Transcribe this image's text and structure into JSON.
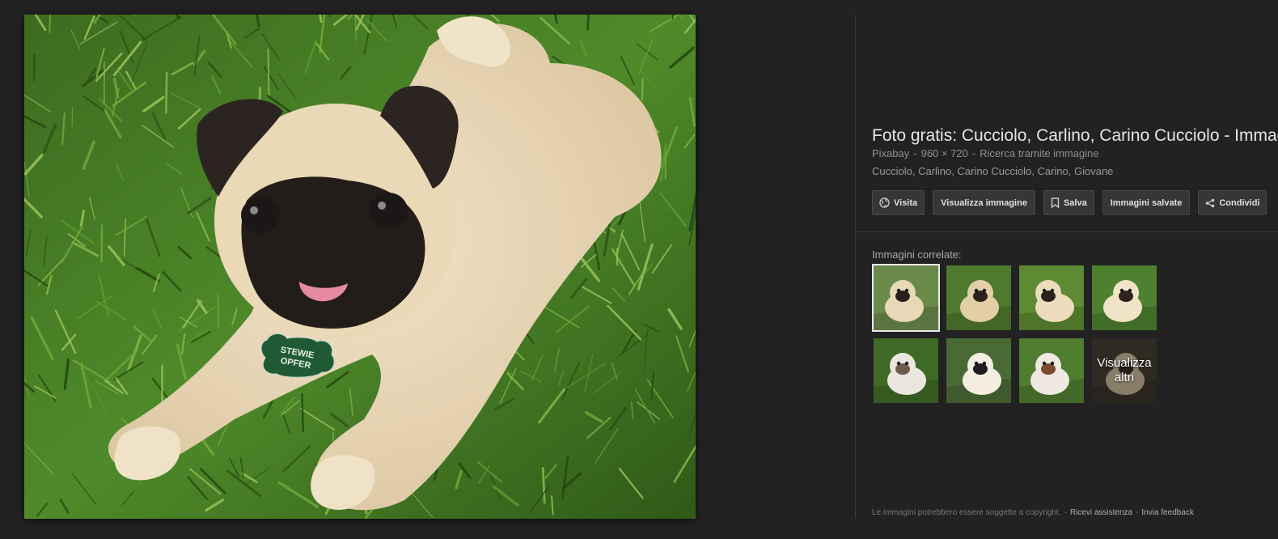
{
  "preview": {
    "tag_text_line1": "STEWIE",
    "tag_text_line2": "OPFER"
  },
  "info": {
    "title": "Foto gratis: Cucciolo, Carlino, Carino Cucciolo - Immagine gratis su Pixabay",
    "source": "Pixabay",
    "dimensions": "960 × 720",
    "search_by_image": "Ricerca tramite immagine",
    "tags": "Cucciolo, Carlino, Carino Cucciolo, Carino, Giovane"
  },
  "buttons": {
    "visit": {
      "label": "Visita",
      "icon": "globe-icon"
    },
    "view_image": {
      "label": "Visualizza immagine"
    },
    "save": {
      "label": "Salva",
      "icon": "bookmark-icon"
    },
    "saved_images": {
      "label": "Immagini salvate"
    },
    "share": {
      "label": "Condividi",
      "icon": "share-icon"
    }
  },
  "related": {
    "label": "Immagini correlate:",
    "view_more_label": "Visualizza altri",
    "thumbnails": [
      {
        "desc": "pug lying on grass",
        "bg": "#6a8a4a",
        "dog": "#e7d8b8",
        "face": "#2a211c",
        "selected": true
      },
      {
        "desc": "pug puppy on grass",
        "bg": "#4f7a2e",
        "dog": "#e2cfa8",
        "face": "#2b221c",
        "selected": false
      },
      {
        "desc": "pug on green grass",
        "bg": "#5d8a33",
        "dog": "#ecdcbb",
        "face": "#2a211b",
        "selected": false
      },
      {
        "desc": "pug standing on grass",
        "bg": "#4d8130",
        "dog": "#f0e3c6",
        "face": "#2d241e",
        "selected": false
      },
      {
        "desc": "puppies in grass",
        "bg": "#3e6a25",
        "dog": "#ece6e0",
        "face": "#6e5a4b",
        "selected": false
      },
      {
        "desc": "white puppy in tuxedo",
        "bg": "#4a6a34",
        "dog": "#f3ede2",
        "face": "#1f1f22",
        "selected": false
      },
      {
        "desc": "small dog on grass",
        "bg": "#4f7c2f",
        "dog": "#efe9e2",
        "face": "#7a4b2c",
        "selected": false
      },
      {
        "desc": "pug close up",
        "bg": "#4a4235",
        "dog": "#cfc0a2",
        "face": "#3a2f27",
        "selected": false
      }
    ]
  },
  "footer": {
    "copyright": "Le immagini potrebbero essere soggette a copyright.",
    "help": "Ricevi assistenza",
    "feedback": "Invia feedback"
  },
  "colors": {
    "background": "#222222",
    "button_bg": "#363636",
    "text": "#e6e6e6"
  }
}
